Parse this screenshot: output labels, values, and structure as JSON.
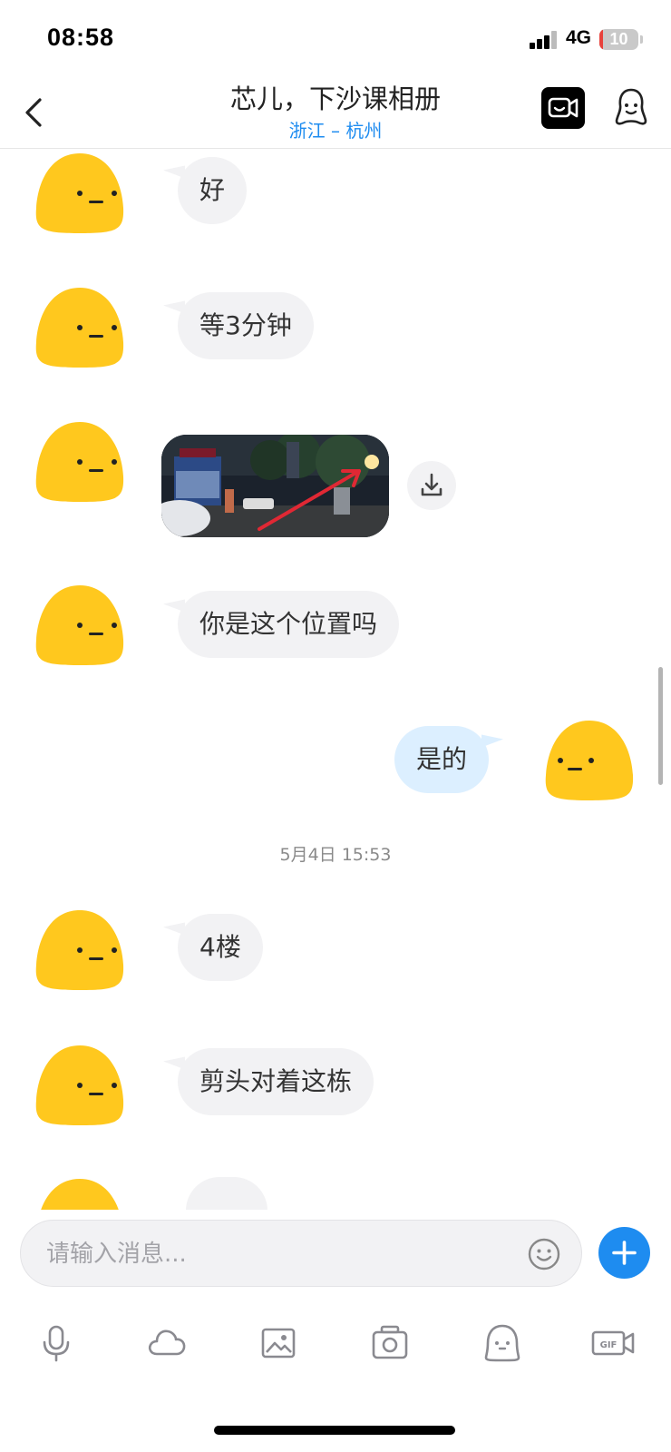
{
  "status_bar": {
    "time": "08:58",
    "network": "4G",
    "battery": "10",
    "battery_level": 0.1
  },
  "header": {
    "title": "芯儿，下沙课相册",
    "subtitle": "浙江 – 杭州"
  },
  "messages": [
    {
      "text": "好"
    },
    {
      "text": "等3分钟"
    },
    {
      "text": "你是这个位置吗"
    },
    {
      "text": "是的"
    },
    {
      "text": "4楼"
    },
    {
      "text": "剪头对着这栋"
    }
  ],
  "timestamp": "5月4日 15:53",
  "input": {
    "placeholder": "请输入消息..."
  },
  "toolbar": [
    "mic-icon",
    "cloud-icon",
    "image-icon",
    "camera-icon",
    "emoji-icon",
    "gif-icon"
  ],
  "colors": {
    "accent": "#1e8cf0",
    "avatar": "#ffc81e",
    "outgoing_bubble": "#dcefff",
    "incoming_bubble": "#f2f2f4"
  }
}
